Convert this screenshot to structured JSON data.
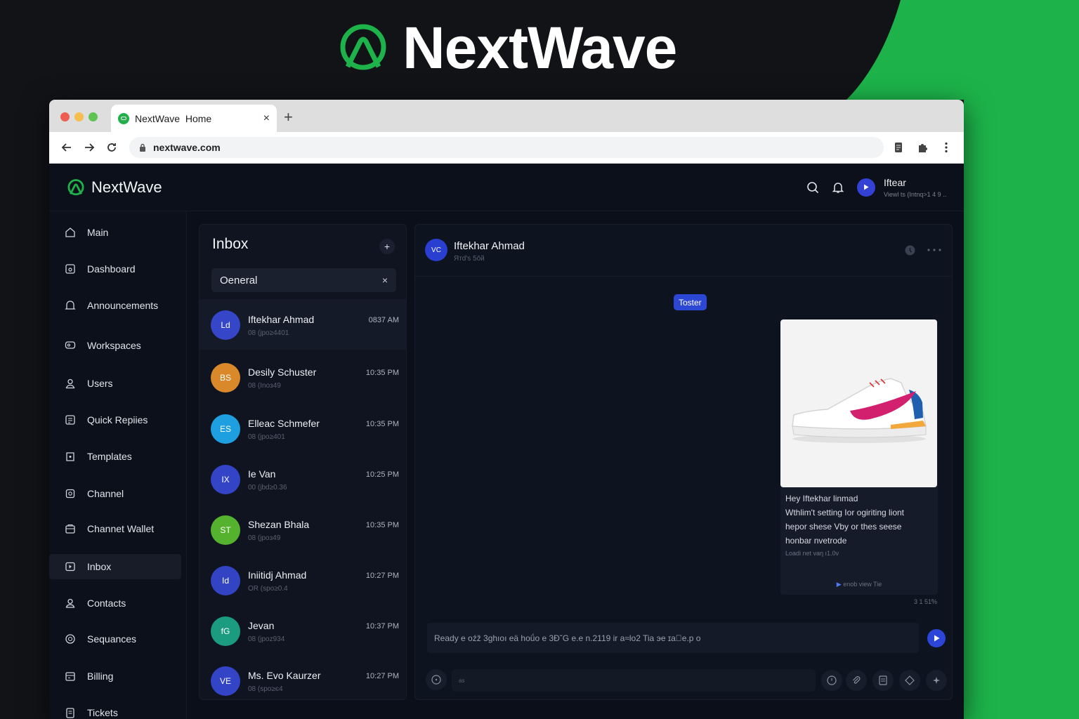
{
  "hero": {
    "title": "NextWave",
    "logo_icon": "nextwave-logo-icon"
  },
  "colors": {
    "brand_green": "#1db34a",
    "accent_blue": "#2d45d9",
    "background": "#111317"
  },
  "browser": {
    "tab_title": "NextWave  Home",
    "tab_close": "×",
    "new_tab": "+",
    "url": "nextwave.com"
  },
  "app": {
    "brand_name": "NextWave",
    "user": {
      "name": "Iftear",
      "subtitle": "Viewl ts (Intnq>1 4 9 ..."
    }
  },
  "sidebar": {
    "items": [
      {
        "label": "Main",
        "icon": "home-icon"
      },
      {
        "label": "Dashboard",
        "icon": "dashboard-icon"
      },
      {
        "label": "Announcements",
        "icon": "bell-icon"
      },
      {
        "label": "Workspaces",
        "icon": "workspaces-icon"
      },
      {
        "label": "Users",
        "icon": "user-icon"
      },
      {
        "label": "Quick Repiies",
        "icon": "quick-replies-icon"
      },
      {
        "label": "Templates",
        "icon": "templates-icon"
      },
      {
        "label": "Channel",
        "icon": "channel-icon"
      },
      {
        "label": "Channet Wallet",
        "icon": "wallet-icon"
      },
      {
        "label": "Inbox",
        "icon": "inbox-icon",
        "active": true
      },
      {
        "label": "Contacts",
        "icon": "contacts-icon"
      },
      {
        "label": "Sequances",
        "icon": "sequences-icon"
      },
      {
        "label": "Billing",
        "icon": "billing-icon"
      },
      {
        "label": "Tickets",
        "icon": "tickets-icon"
      }
    ]
  },
  "inbox": {
    "title": "Inbox",
    "add_label": "+",
    "filter_value": "Oeneral",
    "filter_clear": "×",
    "conversations": [
      {
        "initials": "Ld",
        "name": "Iftekhar Ahmad",
        "preview": "08 (jpo≥4401",
        "time": "0837 AM",
        "color": "#3546c9",
        "active": true
      },
      {
        "initials": "BS",
        "name": "Desily Schuster",
        "preview": "08 (Inoз49",
        "time": "10:35 PM",
        "color": "#d9892a"
      },
      {
        "initials": "ES",
        "name": "Elleac Schmefer",
        "preview": "08 (jpo≥401",
        "time": "10:35 PM",
        "color": "#1e9fe0"
      },
      {
        "initials": "IX",
        "name": "Ie Van",
        "preview": "00 (jbd≥0.36",
        "time": "10:25 PM",
        "color": "#3344c6"
      },
      {
        "initials": "ST",
        "name": "Shezan Bhala",
        "preview": "08 (jpoз49",
        "time": "10:35 PM",
        "color": "#55b22e"
      },
      {
        "initials": "Id",
        "name": "Iniitidj Ahmad",
        "preview": "OR (spo≥0.4",
        "time": "10:27 PM",
        "color": "#3244c4"
      },
      {
        "initials": "fG",
        "name": "Jevan",
        "preview": "08 (jpoz934",
        "time": "10:37 PM",
        "color": "#1b9c80"
      },
      {
        "initials": "VE",
        "name": "Ms. Evo Kaurzer",
        "preview": "08 (spo≥є4",
        "time": "10:27 PM",
        "color": "#3344c6"
      }
    ]
  },
  "chat": {
    "contact_initials": "VC",
    "contact_name": "Iftekhar Ahmad",
    "contact_status": "Ятd's 5ōй",
    "tag": "Toster",
    "message_lines": [
      "Hey Iftekhar linmad",
      "Wthlim't setting Ior ogiriting liont",
      "hepor shese Vby or thes seese",
      "honbar nvetrode"
    ],
    "message_meta": "Loadi net vaη ı1.0ν",
    "message_link": "enob view Tie",
    "message_time": "3 1 51̃%",
    "reply_text": "Ready  e oźž 3ghıoı  eä hoǘo e 3ÐˇG e.e n.2119  ir a≈lo2 Tiа  эе  ɪaᷤe.p o",
    "composer_placeholder": "as"
  }
}
